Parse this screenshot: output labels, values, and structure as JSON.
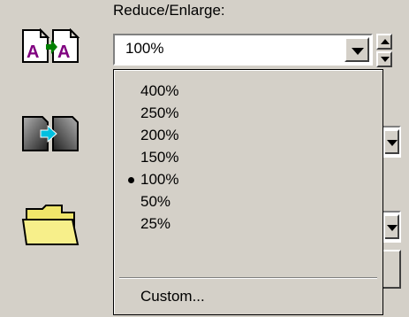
{
  "panel": {
    "label": "Reduce/Enlarge:",
    "selected": "100%"
  },
  "dropdown": {
    "options": [
      "400%",
      "250%",
      "200%",
      "150%",
      "100%",
      "50%",
      "25%"
    ],
    "selected_index": 4,
    "custom": "Custom..."
  },
  "icons": {
    "top": "resize-page-icon",
    "middle": "transparency-page-icon",
    "bottom": "folder-icon"
  },
  "colors": {
    "purple": "#800080",
    "green": "#008000",
    "cyan": "#00c0e0",
    "folder": "#f0e66a"
  }
}
